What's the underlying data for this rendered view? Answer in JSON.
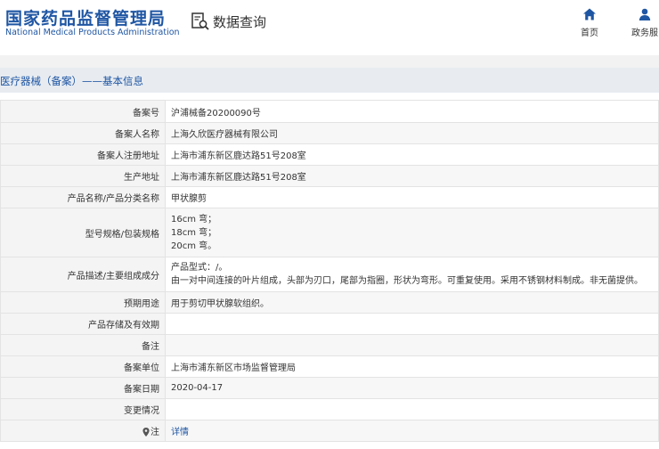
{
  "header": {
    "logo_cn": "国家药品监督管理局",
    "logo_en": "National Medical Products Administration",
    "query_label": "数据查询",
    "nav": [
      {
        "label": "首页",
        "icon": "home-icon"
      },
      {
        "label": "政务服",
        "icon": "user-icon"
      }
    ]
  },
  "page_title": "医疗器械（备案）——基本信息",
  "rows": [
    {
      "label": "备案号",
      "value": "沪浦械备20200090号"
    },
    {
      "label": "备案人名称",
      "value": "上海久欣医疗器械有限公司"
    },
    {
      "label": "备案人注册地址",
      "value": "上海市浦东新区鹿达路51号208室"
    },
    {
      "label": "生产地址",
      "value": "上海市浦东新区鹿达路51号208室"
    },
    {
      "label": "产品名称/产品分类名称",
      "value": "甲状腺剪"
    },
    {
      "label": "型号规格/包装规格",
      "lines": [
        "16cm 弯；",
        "18cm 弯；",
        "20cm 弯。"
      ]
    },
    {
      "label": "产品描述/主要组成成分",
      "lines": [
        "产品型式：/。",
        "由一对中间连接的叶片组成，头部为刃口，尾部为指圈，形状为弯形。可重复使用。采用不锈钢材料制成。非无菌提供。"
      ]
    },
    {
      "label": "预期用途",
      "value": "用于剪切甲状腺软组织。"
    },
    {
      "label": "产品存储及有效期",
      "value": ""
    },
    {
      "label": "备注",
      "value": ""
    },
    {
      "label": "备案单位",
      "value": "上海市浦东新区市场监督管理局"
    },
    {
      "label": "备案日期",
      "value": "2020-04-17"
    },
    {
      "label": "变更情况",
      "value": ""
    },
    {
      "label": "注",
      "value": "详情",
      "icon": "location-pin-icon"
    }
  ],
  "colors": {
    "brand": "#1f56a3"
  }
}
